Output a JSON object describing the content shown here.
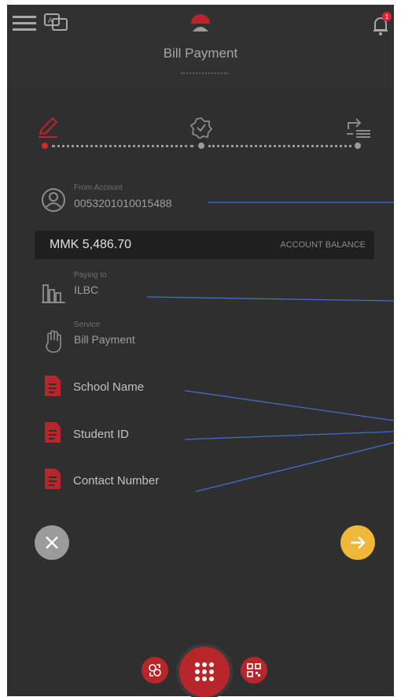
{
  "header": {
    "title": "Bill Payment",
    "notification_count": "1"
  },
  "from_account": {
    "label": "From Account",
    "number": "0053201010015488"
  },
  "balance": {
    "amount": "MMK 5,486.70",
    "label": "ACCOUNT BALANCE"
  },
  "paying_to": {
    "label": "Paying to",
    "value": "ILBC"
  },
  "service": {
    "label": "Service",
    "value": "Bill Payment"
  },
  "fields": [
    {
      "label": "School Name"
    },
    {
      "label": "Student ID"
    },
    {
      "label": "Contact Number"
    }
  ],
  "colors": {
    "accent_red": "#b8262b",
    "confirm_yellow": "#f0b83a",
    "leader_blue": "#3f6fc9"
  },
  "icons": [
    "menu-icon",
    "language-icon",
    "brand-logo-icon",
    "notification-bell-icon",
    "edit-icon",
    "verify-icon",
    "done-icon",
    "user-circle-icon",
    "building-icon",
    "hand-icon",
    "document-icon",
    "close-icon",
    "arrow-right-icon",
    "transfer-icon",
    "keypad-icon",
    "qr-code-icon"
  ]
}
